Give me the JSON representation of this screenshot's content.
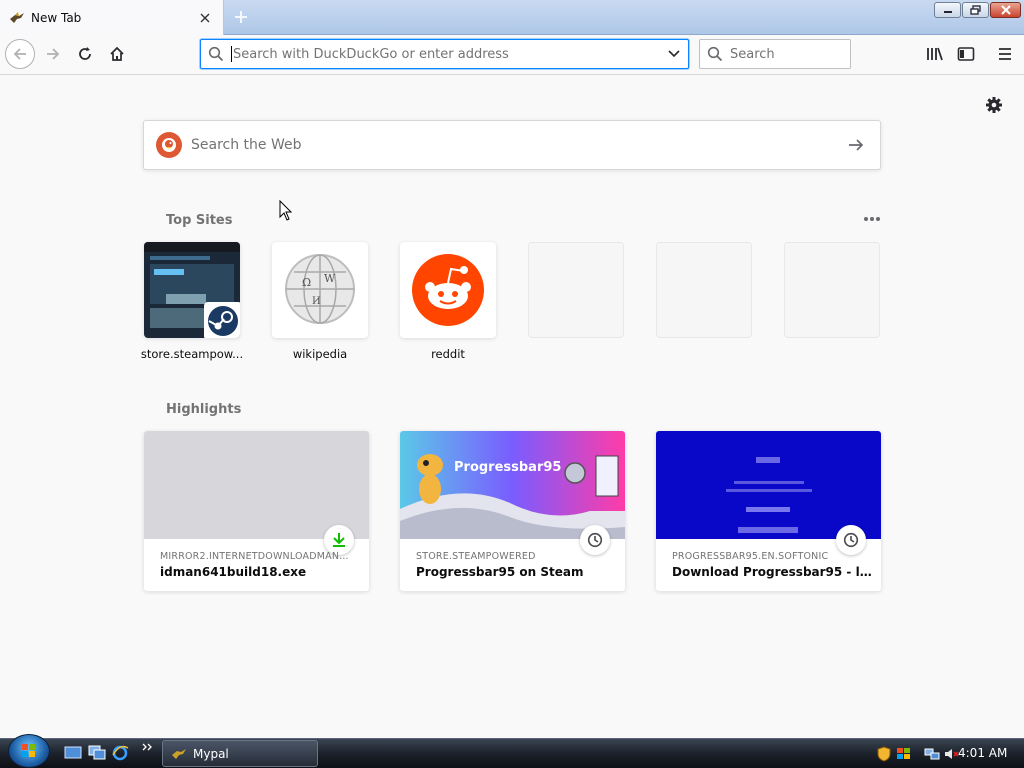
{
  "tab": {
    "title": "New Tab",
    "close_icon": "close-icon",
    "favicon": "mypal-bird-icon"
  },
  "toolbar": {
    "url_placeholder": "Search with DuckDuckGo or enter address",
    "search_placeholder": "Search"
  },
  "newtab": {
    "web_search_placeholder": "Search the Web",
    "top_sites_title": "Top Sites",
    "highlights_title": "Highlights",
    "top_sites": [
      {
        "label": "store.steampow...",
        "icon": "steam-icon"
      },
      {
        "label": "wikipedia",
        "icon": "wikipedia-globe-icon"
      },
      {
        "label": "reddit",
        "icon": "reddit-icon"
      },
      {
        "label": ""
      },
      {
        "label": ""
      },
      {
        "label": ""
      }
    ],
    "highlights": [
      {
        "host": "MIRROR2.INTERNETDOWNLOADMANAGE...",
        "title": "idman641build18.exe",
        "badge": "download-icon"
      },
      {
        "host": "STORE.STEAMPOWERED",
        "title": "Progressbar95 on Steam",
        "badge": "history-clock-icon",
        "thumb_text": "Progressbar95"
      },
      {
        "host": "PROGRESSBAR95.EN.SOFTONIC",
        "title": "Download Progressbar95 - latest...",
        "badge": "history-clock-icon"
      }
    ]
  },
  "taskbar": {
    "app_label": "Mypal",
    "clock": "4:01 AM"
  },
  "colors": {
    "accent": "#0a84ff",
    "duckduckgo": "#de5833",
    "reddit": "#ff4500",
    "softonic_blue": "#0a08c8",
    "download_green": "#12bc00"
  }
}
